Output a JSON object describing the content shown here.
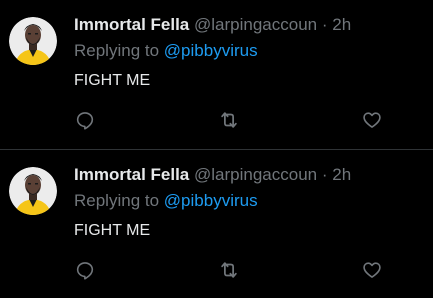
{
  "feed": {
    "tweets": [
      {
        "display_name": "Immortal Fella",
        "handle": "@larpingaccoun",
        "separator": "·",
        "time": "2h",
        "replying_prefix": "Replying to",
        "replying_to": "@pibbyvirus",
        "text": "FIGHT ME",
        "icons": [
          "reply-icon",
          "retweet-icon",
          "like-icon"
        ]
      },
      {
        "display_name": "Immortal Fella",
        "handle": "@larpingaccoun",
        "separator": "·",
        "time": "2h",
        "replying_prefix": "Replying to",
        "replying_to": "@pibbyvirus",
        "text": "FIGHT ME",
        "icons": [
          "reply-icon",
          "retweet-icon",
          "like-icon"
        ]
      }
    ]
  },
  "colors": {
    "background": "#000000",
    "primary_text": "#e7e9ea",
    "secondary_text": "#71767b",
    "link": "#1d9bf0",
    "divider": "#2f3336",
    "avatar_accent": "#f5c518"
  }
}
